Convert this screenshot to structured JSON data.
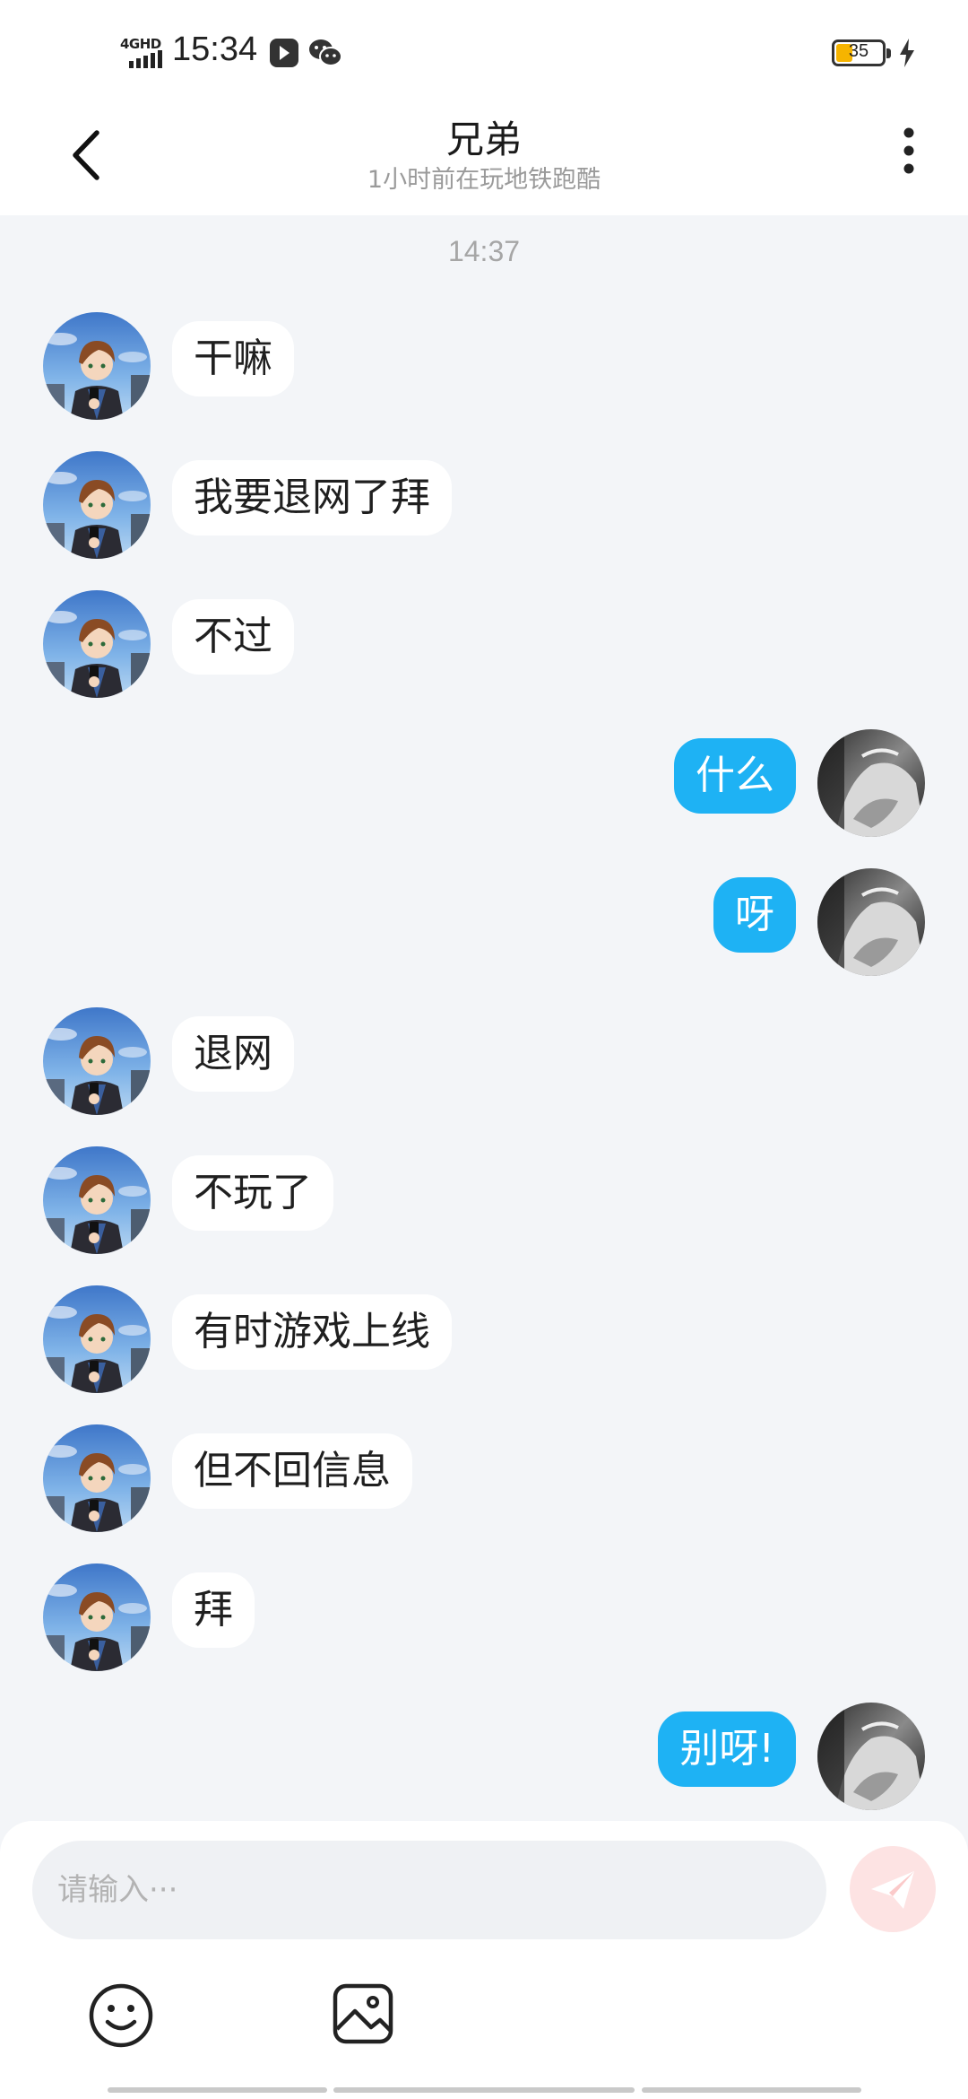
{
  "status_bar": {
    "network": "4GHD",
    "time": "15:34",
    "battery_level": "35",
    "icons": [
      "app-icon",
      "wechat-icon",
      "charging-icon"
    ]
  },
  "header": {
    "title": "兄弟",
    "subtitle": "1小时前在玩地铁跑酷"
  },
  "chat": {
    "timestamp": "14:37",
    "messages": [
      {
        "from": "friend",
        "text": "干嘛"
      },
      {
        "from": "friend",
        "text": "我要退网了拜"
      },
      {
        "from": "friend",
        "text": "不过"
      },
      {
        "from": "me",
        "text": "什么"
      },
      {
        "from": "me",
        "text": "呀"
      },
      {
        "from": "friend",
        "text": "退网"
      },
      {
        "from": "friend",
        "text": "不玩了"
      },
      {
        "from": "friend",
        "text": "有时游戏上线"
      },
      {
        "from": "friend",
        "text": "但不回信息"
      },
      {
        "from": "friend",
        "text": "拜"
      },
      {
        "from": "me",
        "text": "别呀!"
      }
    ]
  },
  "input": {
    "placeholder": "请输入···"
  },
  "colors": {
    "outgoing_bubble": "#1eb2f4",
    "incoming_bubble": "#ffffff",
    "chat_background": "#f3f5f8",
    "send_button_disabled": "#fde3e3",
    "battery_fill": "#f6b400"
  }
}
